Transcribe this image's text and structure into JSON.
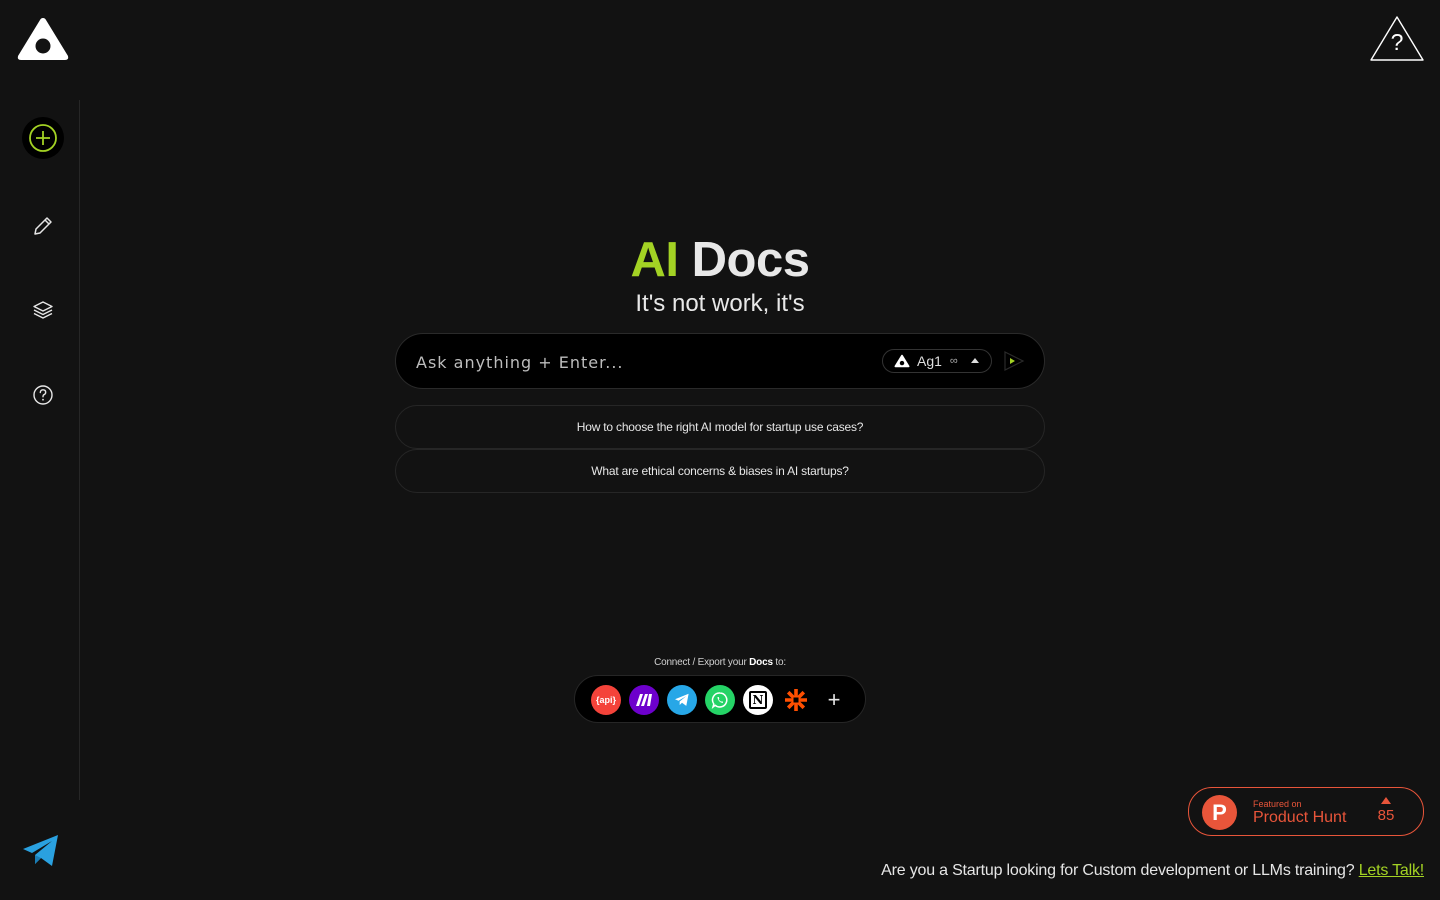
{
  "colors": {
    "background": "#121212",
    "accent": "#a3d224",
    "product_hunt": "#e8553a",
    "input_bg": "#000000"
  },
  "header": {
    "logo_icon": "triangle-logo-icon",
    "help_icon": "triangle-help-icon",
    "help_glyph": "?"
  },
  "sidebar": {
    "items": [
      {
        "name": "new-chat",
        "icon": "plus-circle-icon"
      },
      {
        "name": "edit",
        "icon": "pencil-icon"
      },
      {
        "name": "layers",
        "icon": "layers-icon"
      },
      {
        "name": "help",
        "icon": "question-circle-icon"
      }
    ]
  },
  "hero": {
    "title_accent": "AI",
    "title_rest": "Docs",
    "subtitle": "It's not work, it's"
  },
  "search": {
    "placeholder": "Ask anything + Enter...",
    "model_label": "Ag1",
    "model_suffix": "∞",
    "send_icon": "play-send-icon"
  },
  "suggestions": [
    "How to choose the right AI model for startup use cases?",
    "What are ethical concerns & biases in AI startups?"
  ],
  "connect": {
    "label_prefix": "Connect / Export your ",
    "label_bold": "Docs",
    "label_suffix": " to:",
    "integrations": [
      {
        "name": "api",
        "icon": "api-icon",
        "color": "#f4433a",
        "text": "{api}"
      },
      {
        "name": "make",
        "icon": "make-icon",
        "color": "#6d00cc"
      },
      {
        "name": "telegram",
        "icon": "telegram-icon",
        "color": "#27a7e7"
      },
      {
        "name": "whatsapp",
        "icon": "whatsapp-icon",
        "color": "#25d366"
      },
      {
        "name": "notion",
        "icon": "notion-icon",
        "color": "#ffffff",
        "text": "N"
      },
      {
        "name": "zapier",
        "icon": "zapier-icon",
        "color": "#ff4f00"
      },
      {
        "name": "more",
        "icon": "plus-icon",
        "text": "+"
      }
    ]
  },
  "product_hunt": {
    "letter": "P",
    "featured": "Featured on",
    "name": "Product Hunt",
    "count": "85"
  },
  "footer": {
    "text": "Are you a Startup looking for Custom development or LLMs training? ",
    "link": "Lets Talk!"
  },
  "corner_icon": "telegram-plane-icon"
}
